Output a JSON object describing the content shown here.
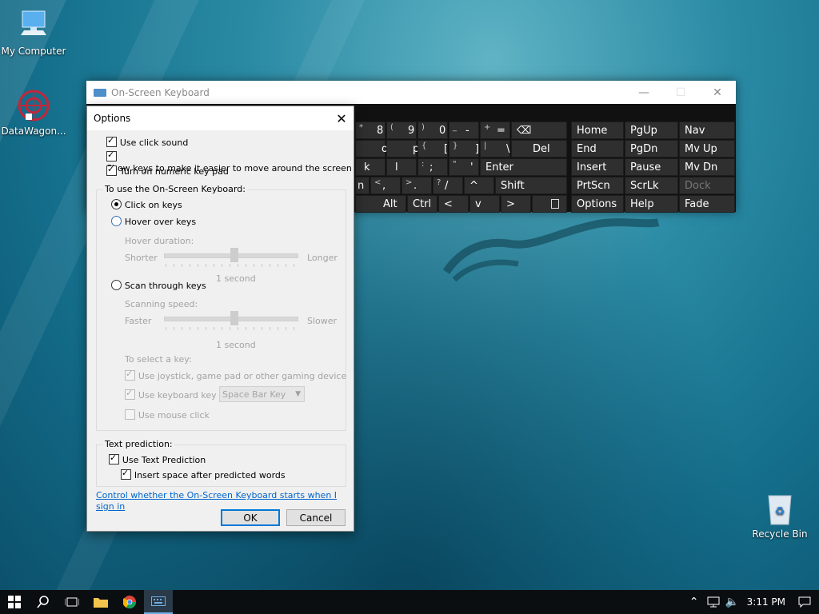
{
  "desktop": {
    "icons": [
      {
        "label": "My Computer",
        "icon": "computer-icon"
      },
      {
        "label": "DataWagon...",
        "icon": "datawagon-icon"
      },
      {
        "label": "Recycle Bin",
        "icon": "recycle-bin-icon"
      }
    ]
  },
  "osk": {
    "title": "On-Screen Keyboard",
    "keys": {
      "r1": [
        {
          "sub": "*",
          "main": "8"
        },
        {
          "sub": "(",
          "main": "9"
        },
        {
          "sub": ")",
          "main": "0"
        },
        {
          "sub": "_",
          "main": "-"
        },
        {
          "sub": "+",
          "main": "="
        },
        {
          "main": "⌫"
        }
      ],
      "r2": [
        {
          "main": "o"
        },
        {
          "main": "p"
        },
        {
          "sub": "{",
          "main": "["
        },
        {
          "sub": "}",
          "main": "]"
        },
        {
          "sub": "|",
          "main": "\\"
        },
        {
          "main": "Del"
        }
      ],
      "r3": [
        {
          "main": "k"
        },
        {
          "main": "l"
        },
        {
          "sub": ":",
          "main": ";"
        },
        {
          "sub": "\"",
          "main": "'"
        },
        {
          "main": "Enter"
        }
      ],
      "r4": [
        {
          "main": "n"
        },
        {
          "sub": "<",
          "main": ","
        },
        {
          "sub": ">",
          "main": "."
        },
        {
          "sub": "?",
          "main": "/"
        },
        {
          "main": "^"
        },
        {
          "main": "Shift"
        }
      ],
      "r5": [
        {
          "main": "Alt"
        },
        {
          "main": "Ctrl"
        },
        {
          "main": "<"
        },
        {
          "main": "v"
        },
        {
          "main": ">"
        },
        {
          "main": "menu"
        }
      ],
      "nav": [
        [
          "Home",
          "PgUp",
          "Nav"
        ],
        [
          "End",
          "PgDn",
          "Mv Up"
        ],
        [
          "Insert",
          "Pause",
          "Mv Dn"
        ],
        [
          "PrtScn",
          "ScrLk",
          "Dock"
        ],
        [
          "Options",
          "Help",
          "Fade"
        ]
      ]
    }
  },
  "options": {
    "title": "Options",
    "use_click_sound": "Use click sound",
    "show_keys": "Show keys to make it easier to move around the screen",
    "numeric_pad": "Turn on numeric key pad",
    "group_use": "To use the On-Screen Keyboard:",
    "click_on_keys": "Click on keys",
    "hover_over_keys": "Hover over keys",
    "hover_duration": "Hover duration:",
    "shorter": "Shorter",
    "longer": "Longer",
    "hover_value": "1 second",
    "scan_through_keys": "Scan through keys",
    "scanning_speed": "Scanning speed:",
    "faster": "Faster",
    "slower": "Slower",
    "scan_value": "1 second",
    "to_select": "To select a key:",
    "use_joystick": "Use joystick, game pad or other gaming device",
    "use_keyboard_key": "Use keyboard key",
    "keyboard_key_value": "Space Bar Key",
    "use_mouse_click": "Use mouse click",
    "group_text": "Text prediction:",
    "use_text_prediction": "Use Text Prediction",
    "insert_space": "Insert space after predicted words",
    "link": "Control whether the On-Screen Keyboard starts when I sign in",
    "ok": "OK",
    "cancel": "Cancel"
  },
  "taskbar": {
    "clock": "3:11 PM"
  }
}
